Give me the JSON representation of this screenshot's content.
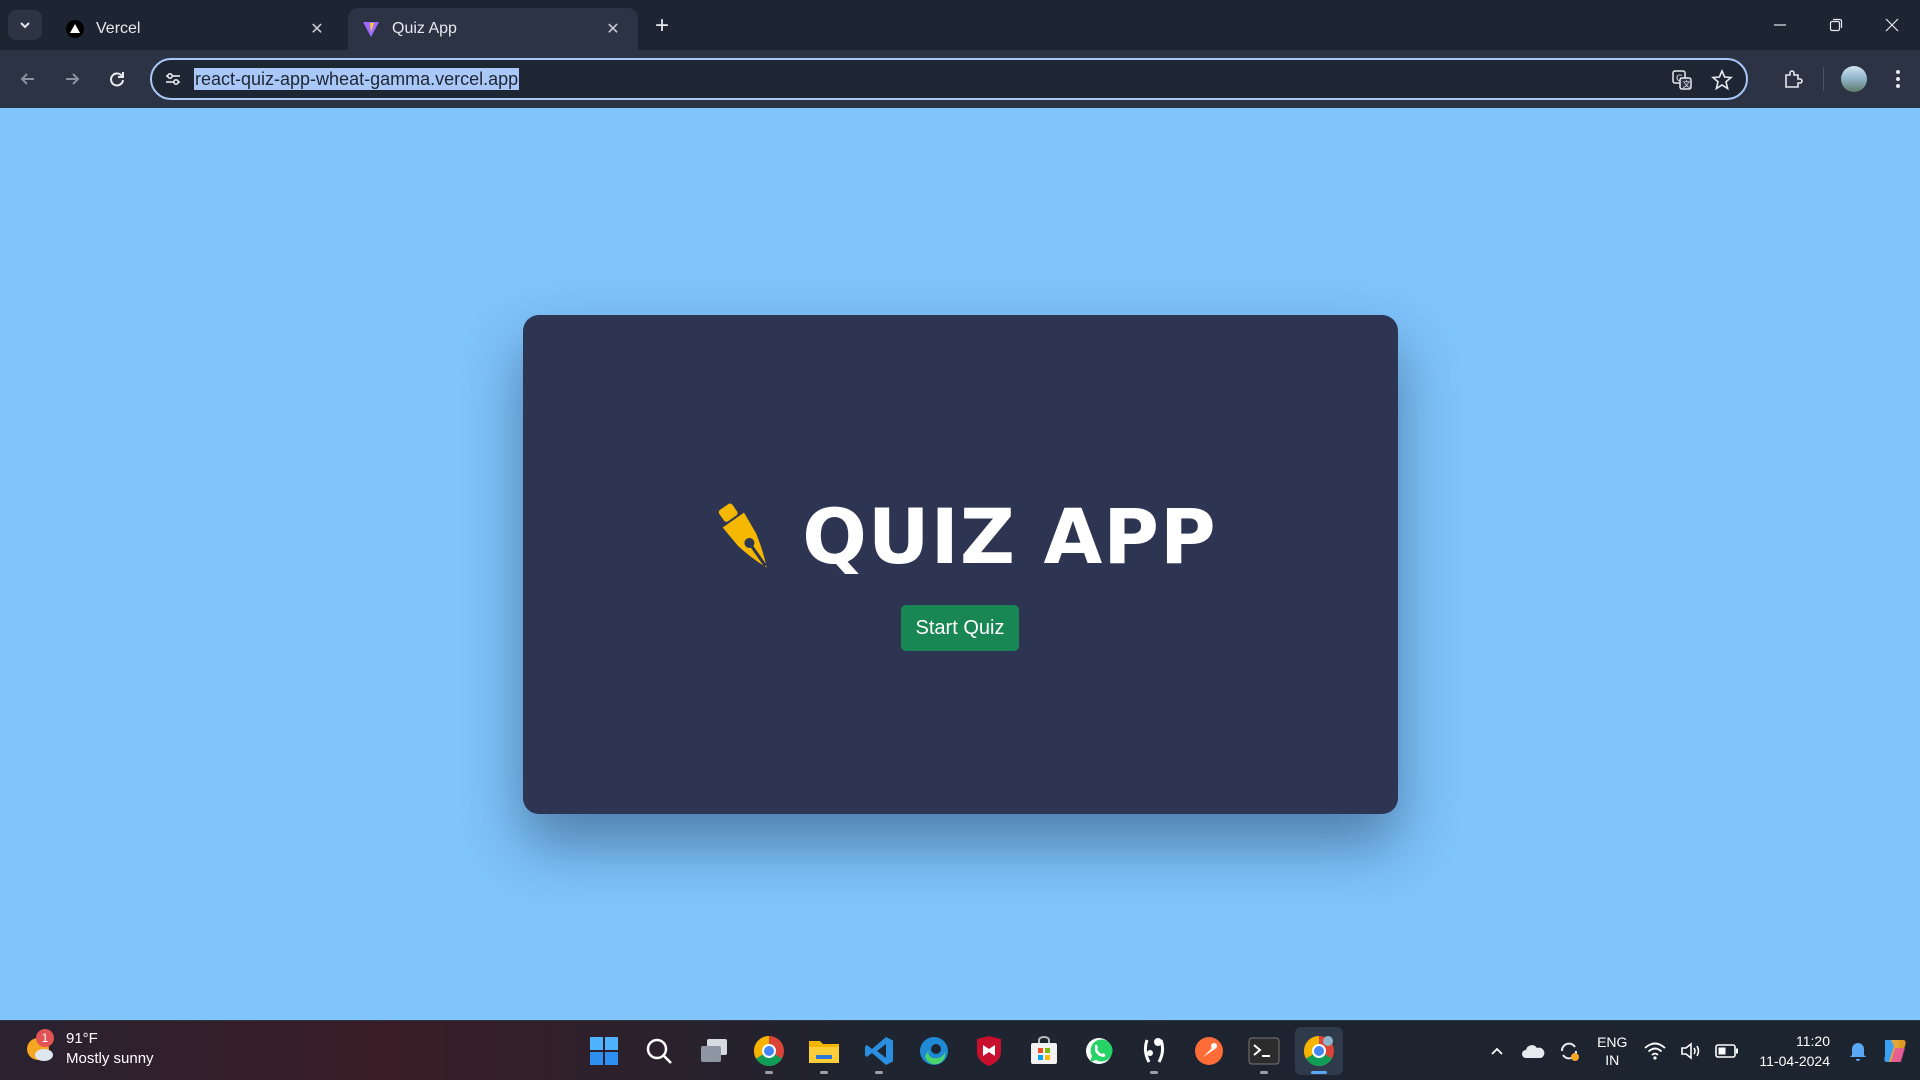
{
  "browser": {
    "tabs": [
      {
        "title": "Vercel",
        "favicon": "vercel-triangle-icon",
        "active": false
      },
      {
        "title": "Quiz App",
        "favicon": "vite-logo-icon",
        "active": true
      }
    ],
    "url": "react-quiz-app-wheat-gamma.vercel.app"
  },
  "page": {
    "background_color": "#7fc4fb",
    "card_color": "#2e3552",
    "title": "QUIZ APP",
    "title_icon": "fountain-pen-icon",
    "start_button_label": "Start Quiz",
    "accent_color": "#198754",
    "icon_color": "#f5b800"
  },
  "taskbar": {
    "weather": {
      "badge": "1",
      "temperature": "91°F",
      "condition": "Mostly sunny"
    },
    "apps": [
      "start-icon",
      "search-icon",
      "task-view-icon",
      "chrome-icon",
      "file-explorer-icon",
      "vscode-icon",
      "edge-icon",
      "mcafee-icon",
      "microsoft-store-icon",
      "whatsapp-icon",
      "github-desktop-icon",
      "postman-icon",
      "terminal-icon",
      "chrome-active-icon"
    ],
    "language": {
      "line1": "ENG",
      "line2": "IN"
    },
    "clock": {
      "time": "11:20",
      "date": "11-04-2024"
    }
  }
}
